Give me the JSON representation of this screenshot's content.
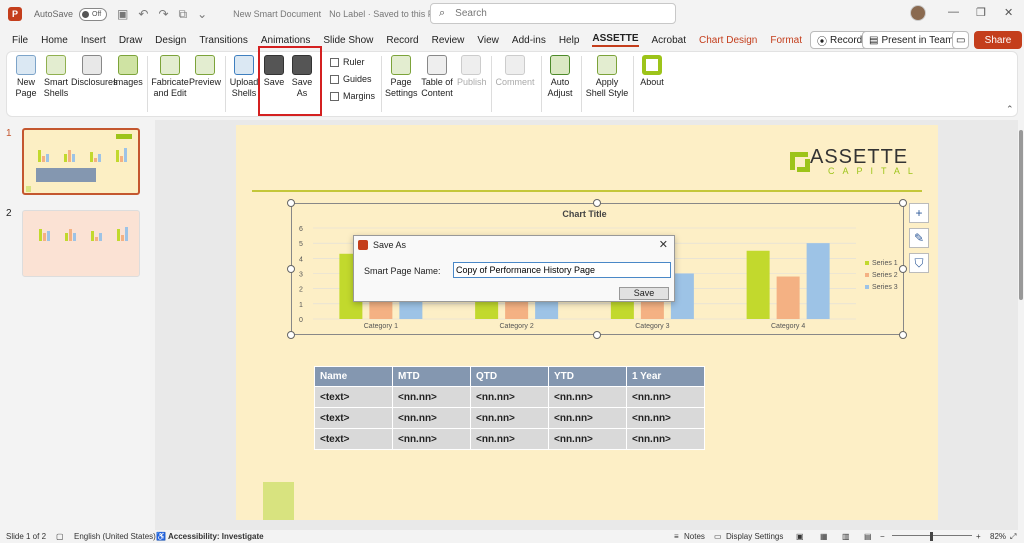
{
  "titlebar": {
    "app_icon": "P",
    "autosave_label": "AutoSave",
    "autosave_state": "Off",
    "doc_title": "New Smart Document",
    "label_info": "No Label · Saved to this PC",
    "search_placeholder": "Search",
    "controls": [
      "—",
      "❐",
      "✕"
    ]
  },
  "tabs": [
    "File",
    "Home",
    "Insert",
    "Draw",
    "Design",
    "Transitions",
    "Animations",
    "Slide Show",
    "Record",
    "Review",
    "View",
    "Add-ins",
    "Help",
    "ASSETTE",
    "Acrobat",
    "Chart Design",
    "Format"
  ],
  "active_tab": "ASSETTE",
  "tab_right": {
    "record": "Record",
    "present": "Present in Teams",
    "share": "Share"
  },
  "ribbon": {
    "new_page": "New Page",
    "smart_shells": "Smart Shells",
    "disclosures": "Disclosures",
    "images": "Images",
    "fabricate": "Fabricate and Edit",
    "preview": "Preview",
    "upload_shells": "Upload Shells",
    "save": "Save",
    "save_as": "Save As",
    "ruler": "Ruler",
    "guides": "Guides",
    "margins": "Margins",
    "page_settings": "Page Settings",
    "toc": "Table of Content",
    "publish": "Publish",
    "comment": "Comment",
    "auto_adjust": "Auto Adjust",
    "apply_shell": "Apply Shell Style",
    "about": "About"
  },
  "slides": [
    "1",
    "2"
  ],
  "logo": {
    "main": "ASSETTE",
    "sub": "CAPITAL"
  },
  "chart_data": {
    "type": "bar",
    "title": "Chart Title",
    "categories": [
      "Category 1",
      "Category 2",
      "Category 3",
      "Category 4"
    ],
    "series": [
      {
        "name": "Series 1",
        "values": [
          4.3,
          2.5,
          3.5,
          4.5
        ]
      },
      {
        "name": "Series 2",
        "values": [
          2.4,
          4.4,
          1.8,
          2.8
        ]
      },
      {
        "name": "Series 3",
        "values": [
          2,
          2,
          3,
          5
        ]
      }
    ],
    "colors": [
      "#c2d92d",
      "#f4b183",
      "#9dc3e6"
    ],
    "ylim": [
      0,
      6
    ],
    "yticks": [
      "0",
      "1",
      "2",
      "3",
      "4",
      "5",
      "6"
    ],
    "legend": "right"
  },
  "table": {
    "headers": [
      "Name",
      "MTD",
      "QTD",
      "YTD",
      "1 Year"
    ],
    "rows": [
      [
        "<text>",
        "<nn.nn>",
        "<nn.nn>",
        "<nn.nn>",
        "<nn.nn>"
      ],
      [
        "<text>",
        "<nn.nn>",
        "<nn.nn>",
        "<nn.nn>",
        "<nn.nn>"
      ],
      [
        "<text>",
        "<nn.nn>",
        "<nn.nn>",
        "<nn.nn>",
        "<nn.nn>"
      ]
    ]
  },
  "dialog": {
    "title": "Save As",
    "label": "Smart Page Name:",
    "value": "Copy of Performance History Page",
    "save_label": "Save",
    "close": "✕"
  },
  "statusbar": {
    "slide": "Slide 1 of 2",
    "language": "English (United States)",
    "accessibility": "Accessibility: Investigate",
    "notes": "Notes",
    "display": "Display Settings",
    "zoom": "82%"
  }
}
